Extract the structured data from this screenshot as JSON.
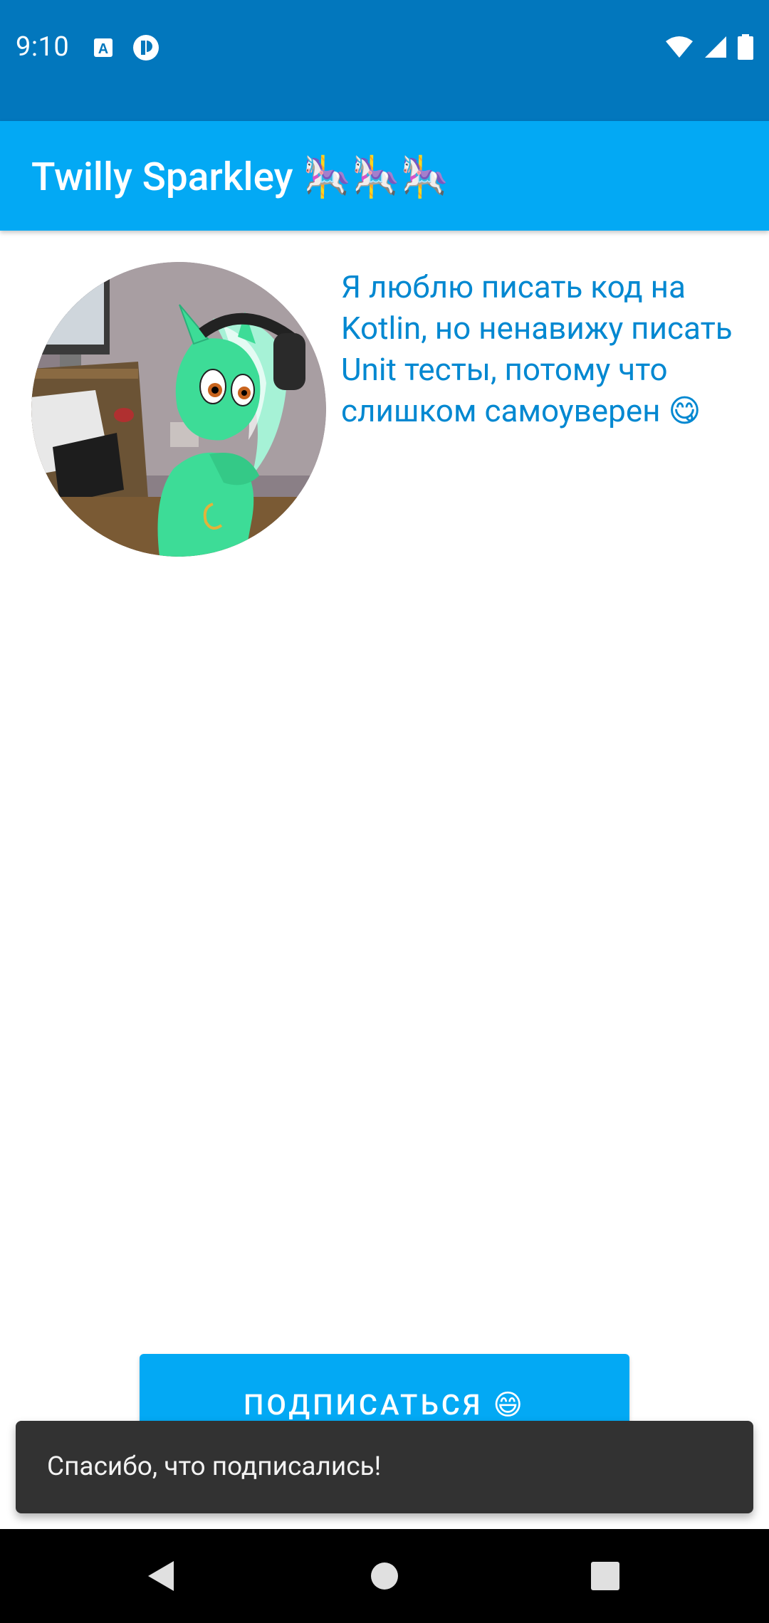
{
  "status_bar": {
    "time": "9:10",
    "icons": [
      "app-notification-icon",
      "app-notification-icon-2",
      "wifi-icon",
      "cell-signal-icon",
      "battery-icon"
    ]
  },
  "app_bar": {
    "title": "Twilly Sparkley 🎠🎠🎠"
  },
  "profile": {
    "avatar": "pony-avatar",
    "bio": "Я люблю писать код на Kotlin, но ненавижу писать Unit тесты, потому что слишком самоуверен 😋"
  },
  "subscribe_button": {
    "label": "ПОДПИСАТЬСЯ 😄"
  },
  "snackbar": {
    "message": "Спасибо, что подписались!"
  },
  "nav_bar": {
    "buttons": [
      "back-icon",
      "home-icon",
      "recents-icon"
    ]
  },
  "colors": {
    "status_bar": "#0277bd",
    "app_bar": "#03a9f4",
    "bio_text": "#0288d1",
    "snackbar": "#323232"
  }
}
